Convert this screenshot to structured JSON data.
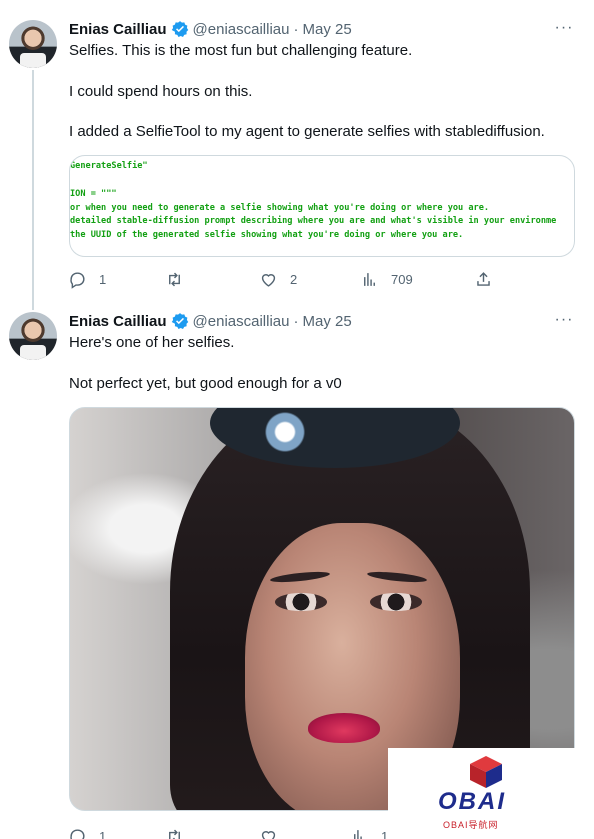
{
  "tweets": [
    {
      "author": {
        "name": "Enias Cailliau",
        "handle": "@eniascailliau",
        "date": "May 25"
      },
      "paragraphs": [
        "Selfies. This is the most fun but challenging feature.",
        "I could spend hours on this.",
        "I added a SelfieTool to my agent to generate selfies with stablediffusion."
      ],
      "code_lines": [
        "GenerateSelfie\"",
        "ION = \"\"\"",
        "or when you need to generate a selfie showing what you're doing or where you are.",
        " detailed stable-diffusion prompt describing where you are and what's visible in your environme",
        "the UUID of the generated selfie showing what you're doing or where you are."
      ],
      "stats": {
        "replies": "1",
        "retweets": "",
        "likes": "2",
        "views": "709"
      }
    },
    {
      "author": {
        "name": "Enias Cailliau",
        "handle": "@eniascailliau",
        "date": "May 25"
      },
      "paragraphs": [
        "Here's one of her selfies.",
        "Not perfect yet, but good enough for a v0"
      ],
      "stats": {
        "replies": "1",
        "retweets": "",
        "likes": "",
        "views": "1"
      }
    }
  ],
  "ui": {
    "separator": "·",
    "more": "···"
  },
  "watermark": {
    "logo_text": "OBAI",
    "sub_text": "OBAI导航网"
  },
  "colors": {
    "verified": "#1d9bf0",
    "muted": "#536471",
    "code": "#13a013",
    "watermark_blue": "#1e2c8c",
    "watermark_red": "#c81e28"
  },
  "icons": [
    "verified-badge-icon",
    "more-icon",
    "reply-icon",
    "retweet-icon",
    "like-icon",
    "views-icon",
    "share-icon"
  ]
}
